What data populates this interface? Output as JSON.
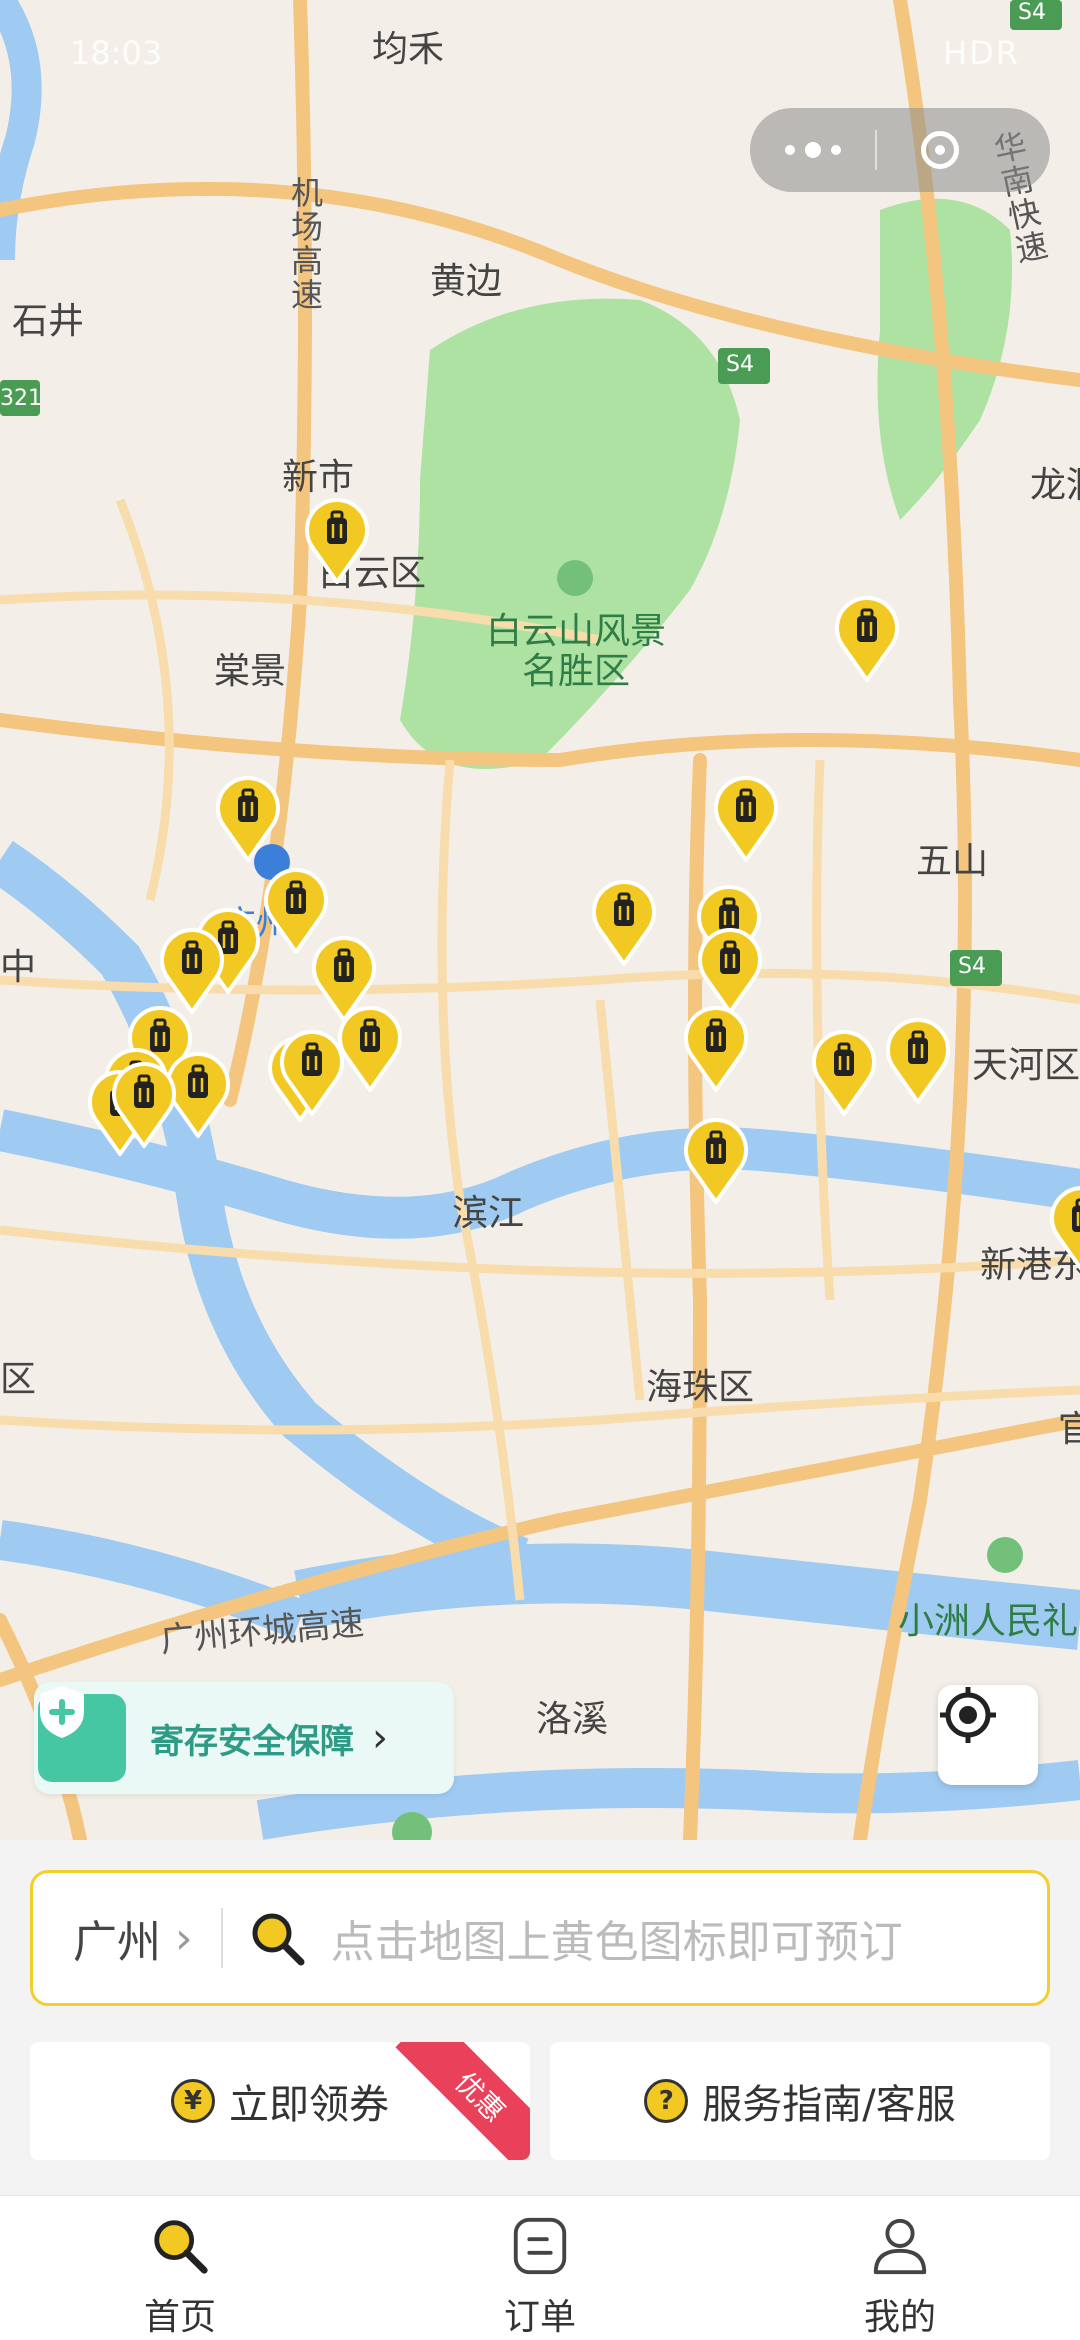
{
  "status_bar": {
    "time": "18:03",
    "indicators": "HDR"
  },
  "map": {
    "labels": [
      {
        "id": "junhe",
        "text": "均禾"
      },
      {
        "id": "shijing",
        "text": "石井"
      },
      {
        "id": "huangbian",
        "text": "黄边"
      },
      {
        "id": "airport_expressway",
        "text": "机场高速"
      },
      {
        "id": "huanan_expressway",
        "text": "华南快速"
      },
      {
        "id": "s4_top",
        "text": "S4"
      },
      {
        "id": "s4_mid",
        "text": "S4"
      },
      {
        "id": "s4_right",
        "text": "S4"
      },
      {
        "id": "g321",
        "text": "321"
      },
      {
        "id": "xinshi",
        "text": "新市"
      },
      {
        "id": "baiyun_district",
        "text": "白云区"
      },
      {
        "id": "baiyunshan",
        "text": "白云山风景名胜区"
      },
      {
        "id": "longdong",
        "text": "龙洞"
      },
      {
        "id": "tangjing",
        "text": "棠景"
      },
      {
        "id": "wushan",
        "text": "五山"
      },
      {
        "id": "guangzhou_station",
        "text": "广州"
      },
      {
        "id": "liwan_partial",
        "text": "中"
      },
      {
        "id": "tianhe",
        "text": "天河区"
      },
      {
        "id": "binjiang",
        "text": "滨江"
      },
      {
        "id": "xingang",
        "text": "新港东"
      },
      {
        "id": "district_left",
        "text": "区"
      },
      {
        "id": "haizhu",
        "text": "海珠区"
      },
      {
        "id": "guan_partial",
        "text": "官"
      },
      {
        "id": "ring_expressway",
        "text": "广州环城高速"
      },
      {
        "id": "xiaozhou",
        "text": "小洲人民礼"
      },
      {
        "id": "luoxi",
        "text": "洛溪"
      }
    ],
    "safety_banner": "寄存安全保障",
    "pin_icon": "luggage-icon",
    "pin_color": "#f2c923"
  },
  "search_bar": {
    "city": "广州",
    "placeholder": "点击地图上黄色图标即可预订"
  },
  "actions": {
    "coupon_label": "立即领券",
    "coupon_icon": "¥",
    "coupon_badge": "优惠",
    "guide_label": "服务指南/客服",
    "guide_icon": "?"
  },
  "tabbar": {
    "home": "首页",
    "orders": "订单",
    "mine": "我的"
  },
  "colors": {
    "accent": "#f2c923",
    "safety": "#46c7a4",
    "badge": "#e9415a",
    "river": "#9fcbf2",
    "park": "#aee2a3"
  }
}
